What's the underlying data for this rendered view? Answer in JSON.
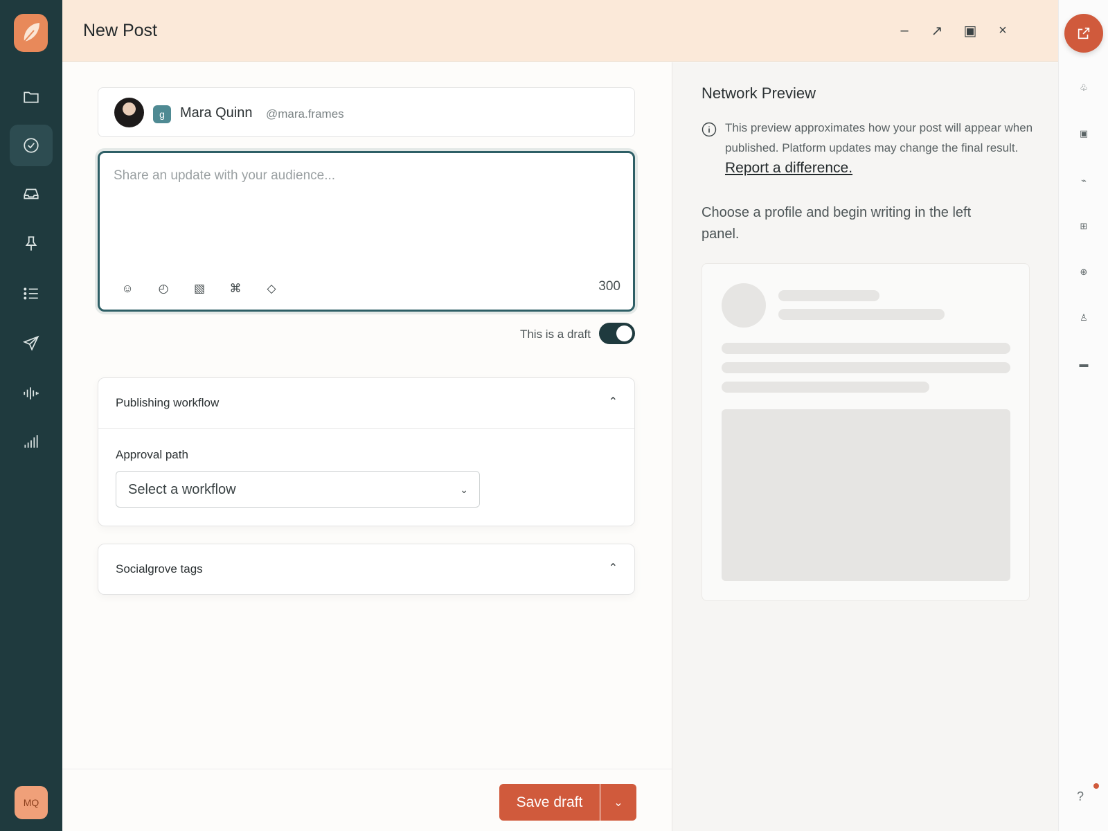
{
  "app": {
    "logo": "leaf-logo"
  },
  "nav": {
    "items": [
      {
        "name": "folder",
        "icon": "folder-icon"
      },
      {
        "name": "approvals",
        "icon": "check-circle-icon",
        "active": true
      },
      {
        "name": "inbox",
        "icon": "inbox-icon"
      },
      {
        "name": "pinned",
        "icon": "pin-icon"
      },
      {
        "name": "list",
        "icon": "list-icon"
      },
      {
        "name": "publish",
        "icon": "send-icon"
      },
      {
        "name": "listening",
        "icon": "audio-wave-icon"
      },
      {
        "name": "analytics",
        "icon": "bar-chart-icon"
      }
    ],
    "user_initials": "MQ"
  },
  "header": {
    "title": "New Post",
    "controls": [
      "minimize-icon",
      "expand-icon",
      "maximize-icon",
      "close-icon"
    ]
  },
  "composer": {
    "profile": {
      "name": "Mara Quinn",
      "handle": "@mara.frames",
      "network_badge": "g"
    },
    "editor": {
      "placeholder": "Share an update with your audience...",
      "char_count": "300"
    },
    "tools": [
      "emoji-icon",
      "clock-icon",
      "image-icon",
      "command-icon",
      "tag-icon"
    ],
    "draft_label": "This is a draft",
    "draft_enabled": true,
    "workflow_panel": {
      "title": "Publishing workflow",
      "field_label": "Approval path",
      "select_value": "Select a workflow"
    },
    "tags_panel": {
      "title": "Socialgrove tags"
    }
  },
  "footer": {
    "save_label": "Save draft"
  },
  "preview": {
    "title": "Network Preview",
    "info_text": "This preview approximates how your post will appear when published. Platform updates may change the final result.",
    "info_link": "Report a difference.",
    "message": "Choose a profile and begin writing in the left panel."
  },
  "rail": {
    "top_icon": "external-link-icon",
    "help": "?"
  },
  "colors": {
    "sidebar": "#1f3a3e",
    "accent": "#d05a3c",
    "header": "#fbe9d9"
  }
}
